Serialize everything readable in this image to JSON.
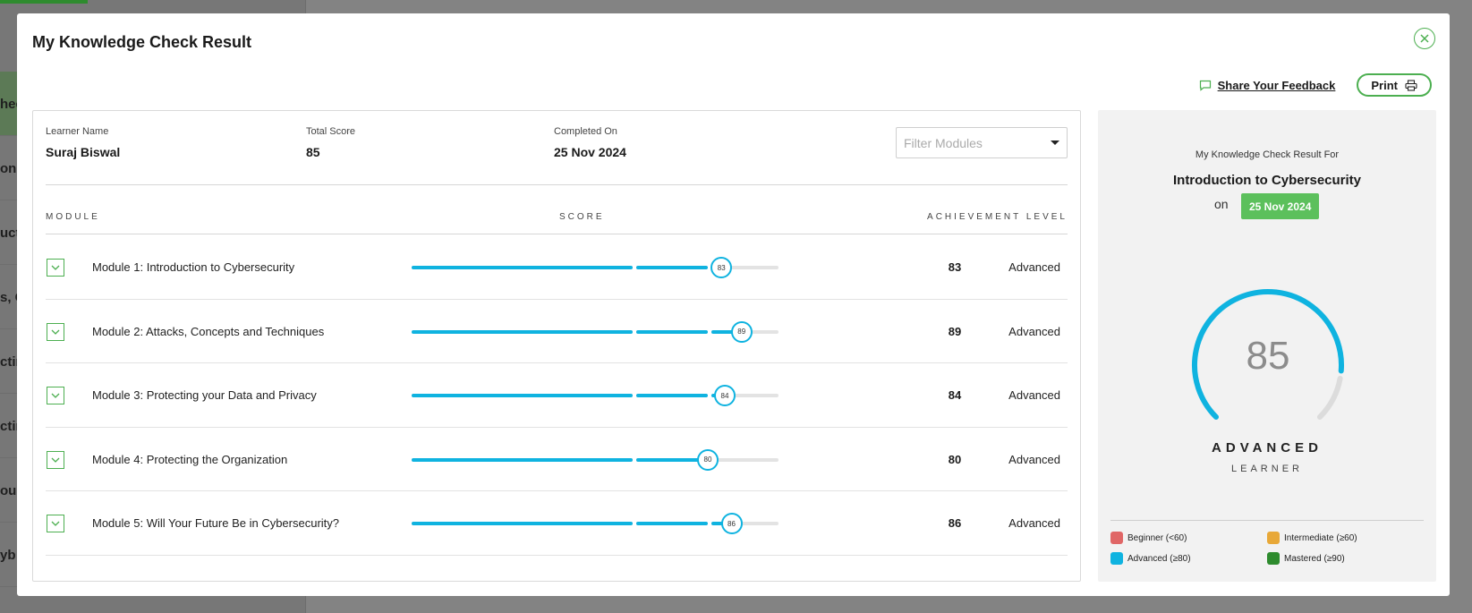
{
  "background": {
    "items": [
      "hec",
      "on T",
      "uct",
      "s, C",
      "ctin",
      "ctin",
      "our",
      "yb"
    ]
  },
  "modal": {
    "title": "My Knowledge Check Result",
    "feedback_label": "Share Your Feedback",
    "print_label": "Print"
  },
  "info": {
    "learner_label": "Learner Name",
    "learner_value": "Suraj Biswal",
    "score_label": "Total Score",
    "score_value": "85",
    "completed_label": "Completed On",
    "completed_value": "25 Nov 2024",
    "filter_placeholder": "Filter Modules"
  },
  "table": {
    "headers": {
      "module": "MODULE",
      "score": "SCORE",
      "level": "ACHIEVEMENT LEVEL"
    },
    "rows": [
      {
        "name": "Module 1: Introduction to Cybersecurity",
        "score": 83,
        "score_text": "83",
        "level": "Advanced"
      },
      {
        "name": "Module 2: Attacks, Concepts and Techniques",
        "score": 89,
        "score_text": "89",
        "level": "Advanced"
      },
      {
        "name": "Module 3: Protecting your Data and Privacy",
        "score": 84,
        "score_text": "84",
        "level": "Advanced"
      },
      {
        "name": "Module 4: Protecting the Organization",
        "score": 80,
        "score_text": "80",
        "level": "Advanced"
      },
      {
        "name": "Module 5: Will Your Future Be in Cybersecurity?",
        "score": 86,
        "score_text": "86",
        "level": "Advanced"
      }
    ]
  },
  "summary": {
    "subtitle": "My Knowledge Check Result For",
    "course": "Introduction to Cybersecurity",
    "on_label": "on",
    "date": "25 Nov 2024",
    "score": 85,
    "score_text": "85",
    "level": "ADVANCED",
    "level_sub": "LEARNER",
    "legend": [
      {
        "label": "Beginner (<60)",
        "color": "#e06666"
      },
      {
        "label": "Intermediate (≥60)",
        "color": "#e8a838"
      },
      {
        "label": "Advanced (≥80)",
        "color": "#0fb3e0"
      },
      {
        "label": "Mastered (≥90)",
        "color": "#2e8b2e"
      }
    ]
  },
  "colors": {
    "accent": "#4caf50",
    "score": "#0fb3e0",
    "track": "#e3e3e3"
  }
}
